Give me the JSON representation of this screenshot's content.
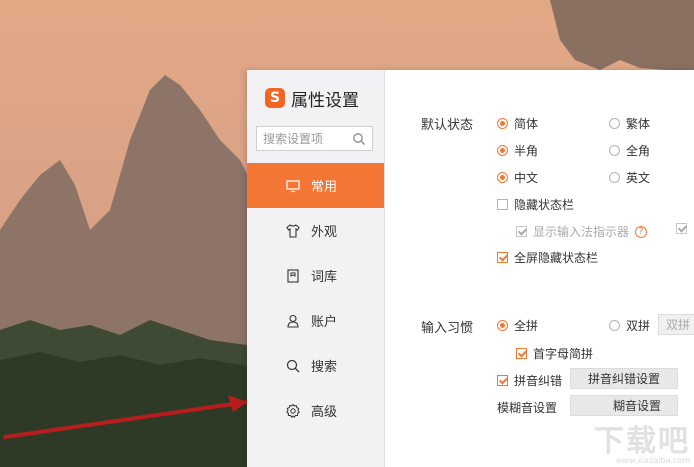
{
  "dialog": {
    "logo_glyph": "S",
    "title": "属性设置",
    "search": {
      "placeholder": "搜索设置项"
    },
    "nav": [
      {
        "label": "常用",
        "icon": "monitor-icon",
        "active": true
      },
      {
        "label": "外观",
        "icon": "shirt-icon",
        "active": false
      },
      {
        "label": "词库",
        "icon": "book-icon",
        "active": false
      },
      {
        "label": "账户",
        "icon": "user-icon",
        "active": false
      },
      {
        "label": "搜索",
        "icon": "search-icon",
        "active": false
      },
      {
        "label": "高级",
        "icon": "gear-icon",
        "active": false
      }
    ]
  },
  "content": {
    "default_state": {
      "label": "默认状态",
      "simplified": {
        "label": "简体",
        "checked": true
      },
      "traditional": {
        "label": "繁体",
        "checked": false
      },
      "half_width": {
        "label": "半角",
        "checked": true
      },
      "full_width": {
        "label": "全角",
        "checked": false
      },
      "chinese": {
        "label": "中文",
        "checked": true
      },
      "english": {
        "label": "英文",
        "checked": false
      },
      "hide_status_bar": {
        "label": "隐藏状态栏",
        "checked": false
      },
      "show_indicator": {
        "label": "显示输入法指示器",
        "checked": true,
        "disabled": true
      },
      "fullscreen_hide": {
        "label": "全屏隐藏状态栏",
        "checked": true
      }
    },
    "input_habit": {
      "label": "输入习惯",
      "full_pinyin": {
        "label": "全拼",
        "checked": true
      },
      "double_pinyin": {
        "label": "双拼",
        "checked": false
      },
      "double_pinyin_button": "双拼",
      "initial_abbrev": {
        "label": "首字母简拼",
        "checked": true
      },
      "pinyin_correction": {
        "label": "拼音纠错",
        "checked": true
      },
      "pinyin_correction_button": "拼音纠错设置",
      "fuzzy_label": "模糊音设置",
      "fuzzy_button": "糊音设置"
    }
  },
  "watermark": {
    "main": "下载吧",
    "sub": "www.xiazaiba.com"
  },
  "colors": {
    "accent": "#f47634",
    "sidebar_bg": "#f2f2f4"
  }
}
